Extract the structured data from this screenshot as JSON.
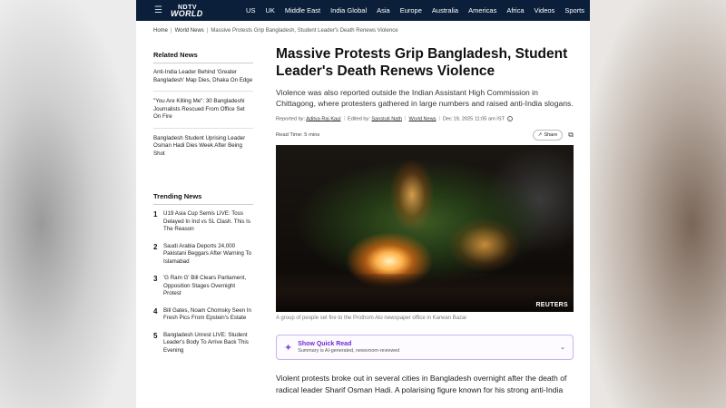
{
  "nav": {
    "logo_top": "NDTV",
    "logo_bottom": "WORLD",
    "links": [
      "US",
      "UK",
      "Middle East",
      "India Global",
      "Asia",
      "Europe",
      "Australia",
      "Americas",
      "Africa",
      "Videos",
      "Sports"
    ]
  },
  "breadcrumb": {
    "home": "Home",
    "section": "World News",
    "current": "Massive Protests Grip Bangladesh, Student Leader's Death Renews Violence"
  },
  "related": {
    "title": "Related News",
    "items": [
      "Anti-India Leader Behind 'Greater Bangladesh' Map Dies, Dhaka On Edge",
      "\"You Are Killing Me\": 30 Bangladeshi Journalists Rescued From Office Set On Fire",
      "Bangladesh Student Uprising Leader Osman Hadi Dies Week After Being Shot"
    ]
  },
  "trending": {
    "title": "Trending News",
    "items": [
      {
        "num": "1",
        "text": "U19 Asia Cup Semis LIVE: Toss Delayed In Ind vs SL Clash. This Is The Reason"
      },
      {
        "num": "2",
        "text": "Saudi Arabia Deports 24,000 Pakistani Beggars After Warning To Islamabad"
      },
      {
        "num": "3",
        "text": "'G Ram G' Bill Clears Parliament, Opposition Stages Overnight Protest"
      },
      {
        "num": "4",
        "text": "Bill Gates, Noam Chomsky Seen In Fresh Pics From Epstein's Estate"
      },
      {
        "num": "5",
        "text": "Bangladesh Unrest LIVE: Student Leader's Body To Arrive Back This Evening"
      }
    ]
  },
  "article": {
    "headline": "Massive Protests Grip Bangladesh, Student Leader's Death Renews Violence",
    "subhead": "Violence was also reported outside the Indian Assistant High Commission in Chittagong, where protesters gathered in large numbers and raised anti-India slogans.",
    "reported_by_label": "Reported by:",
    "reporter": "Aditya Raj Kaul",
    "edited_by_label": "Edited by:",
    "editor": "Sanstuti Nath",
    "section": "World News",
    "date": "Dec 19, 2025 11:05 am IST",
    "read_time": "Read Time: 5 mins",
    "share_label": "Share",
    "photo_credit": "REUTERS",
    "caption": "A group of people set fire to the Prothom Alo newspaper office in Karwan Bazar",
    "quick_read_title": "Show Quick Read",
    "quick_read_sub": "Summary is AI-generated, newsroom-reviewed",
    "body": "Violent protests broke out in several cities in Bangladesh overnight after the death of radical leader Sharif Osman Hadi. A polarising figure known for his strong anti-India"
  }
}
